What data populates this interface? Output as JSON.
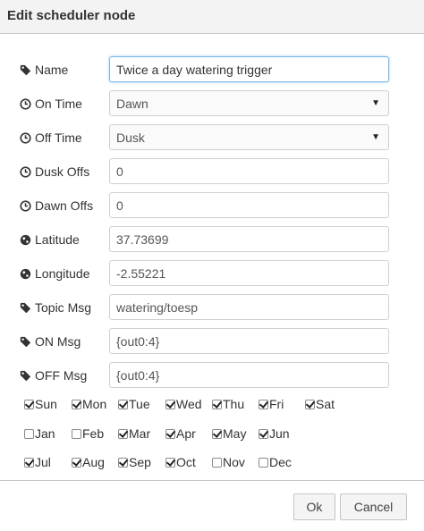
{
  "dialog": {
    "title": "Edit scheduler node"
  },
  "fields": {
    "name": {
      "label": "Name",
      "value": "Twice a day watering trigger",
      "icon": "tag-icon"
    },
    "on_time": {
      "label": "On Time",
      "value": "Dawn",
      "icon": "clock-icon"
    },
    "off_time": {
      "label": "Off Time",
      "value": "Dusk",
      "icon": "clock-icon"
    },
    "dusk_offs": {
      "label": "Dusk Offs",
      "value": "0",
      "icon": "clock-icon"
    },
    "dawn_offs": {
      "label": "Dawn Offs",
      "value": "0",
      "icon": "clock-icon"
    },
    "latitude": {
      "label": "Latitude",
      "value": "37.73699",
      "icon": "globe-icon"
    },
    "longitude": {
      "label": "Longitude",
      "value": "-2.55221",
      "icon": "globe-icon"
    },
    "topic_msg": {
      "label": "Topic Msg",
      "value": "watering/toesp",
      "icon": "tag-icon"
    },
    "on_msg": {
      "label": "ON Msg",
      "value": "{out0:4}",
      "icon": "tag-icon"
    },
    "off_msg": {
      "label": "OFF Msg",
      "value": "{out0:4}",
      "icon": "tag-icon"
    }
  },
  "weekdays": [
    {
      "label": "Sun",
      "checked": true
    },
    {
      "label": "Mon",
      "checked": true
    },
    {
      "label": "Tue",
      "checked": true
    },
    {
      "label": "Wed",
      "checked": true
    },
    {
      "label": "Thu",
      "checked": true
    },
    {
      "label": "Fri",
      "checked": true
    },
    {
      "label": "Sat",
      "checked": true
    }
  ],
  "months": [
    {
      "label": "Jan",
      "checked": false
    },
    {
      "label": "Feb",
      "checked": false
    },
    {
      "label": "Mar",
      "checked": true
    },
    {
      "label": "Apr",
      "checked": true
    },
    {
      "label": "May",
      "checked": true
    },
    {
      "label": "Jun",
      "checked": true
    },
    {
      "label": "Jul",
      "checked": true
    },
    {
      "label": "Aug",
      "checked": true
    },
    {
      "label": "Sep",
      "checked": true
    },
    {
      "label": "Oct",
      "checked": true
    },
    {
      "label": "Nov",
      "checked": false
    },
    {
      "label": "Dec",
      "checked": false
    }
  ],
  "buttons": {
    "ok": "Ok",
    "cancel": "Cancel"
  },
  "colors": {
    "focus_border": "#76b7e8",
    "icon": "#333333"
  }
}
